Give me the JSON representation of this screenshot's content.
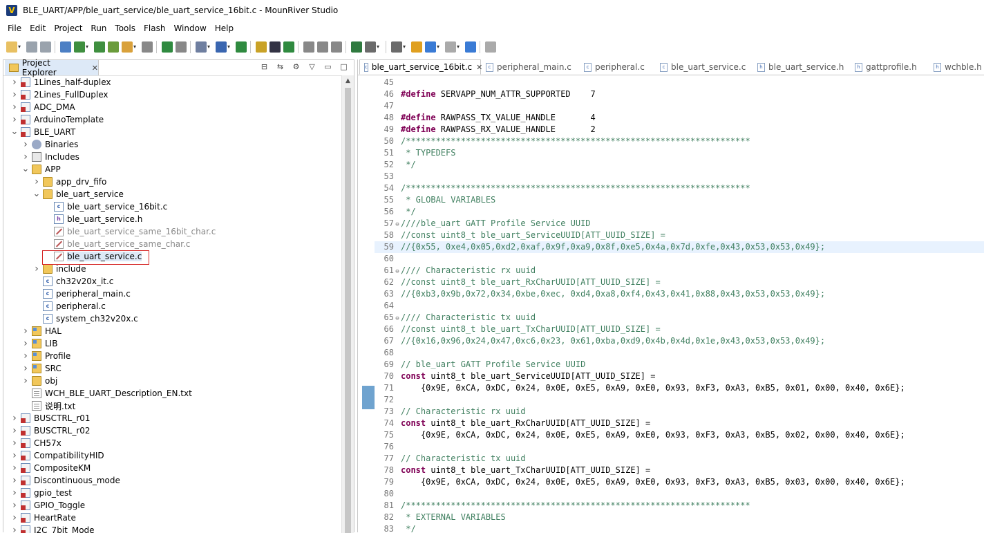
{
  "window": {
    "title": "BLE_UART/APP/ble_uart_service/ble_uart_service_16bit.c - MounRiver Studio",
    "logo": "V"
  },
  "menu": [
    "File",
    "Edit",
    "Project",
    "Run",
    "Tools",
    "Flash",
    "Window",
    "Help"
  ],
  "project_explorer": {
    "tab_label": "Project Explorer",
    "items": [
      {
        "label": "1Lines_half-duplex",
        "icon": "project-icon",
        "chev": ">"
      },
      {
        "label": "2Lines_FullDuplex",
        "icon": "project-icon",
        "chev": ">"
      },
      {
        "label": "ADC_DMA",
        "icon": "project-icon",
        "chev": ">"
      },
      {
        "label": "ArduinoTemplate",
        "icon": "project-icon",
        "chev": ">"
      },
      {
        "label": "BLE_UART",
        "icon": "project-icon",
        "chev": "v"
      },
      {
        "label": "Binaries",
        "icon": "binaries-icon",
        "chev": ">"
      },
      {
        "label": "Includes",
        "icon": "includes-icon",
        "chev": ">"
      },
      {
        "label": "APP",
        "icon": "folder-icon",
        "chev": "v"
      },
      {
        "label": "app_drv_fifo",
        "icon": "folder-icon",
        "chev": ">"
      },
      {
        "label": "ble_uart_service",
        "icon": "folder-icon",
        "chev": "v"
      },
      {
        "label": "ble_uart_service_16bit.c",
        "icon": "c-file-icon",
        "chev": ""
      },
      {
        "label": "ble_uart_service.h",
        "icon": "h-file-icon",
        "chev": ""
      },
      {
        "label": "ble_uart_service_same_16bit_char.c",
        "icon": "excluded-file-icon",
        "chev": ""
      },
      {
        "label": "ble_uart_service_same_char.c",
        "icon": "excluded-file-icon",
        "chev": ""
      },
      {
        "label": "ble_uart_service.c",
        "icon": "excluded-file-icon",
        "chev": ""
      },
      {
        "label": "include",
        "icon": "folder-icon",
        "chev": ">"
      },
      {
        "label": "ch32v20x_it.c",
        "icon": "c-file-icon",
        "chev": ""
      },
      {
        "label": "peripheral_main.c",
        "icon": "c-file-icon",
        "chev": ""
      },
      {
        "label": "peripheral.c",
        "icon": "c-file-icon",
        "chev": ""
      },
      {
        "label": "system_ch32v20x.c",
        "icon": "c-file-icon",
        "chev": ""
      },
      {
        "label": "HAL",
        "icon": "source-folder-icon",
        "chev": ">"
      },
      {
        "label": "LIB",
        "icon": "source-folder-icon",
        "chev": ">"
      },
      {
        "label": "Profile",
        "icon": "source-folder-icon",
        "chev": ">"
      },
      {
        "label": "SRC",
        "icon": "source-folder-icon",
        "chev": ">"
      },
      {
        "label": "obj",
        "icon": "folder-icon",
        "chev": ">"
      },
      {
        "label": "WCH_BLE_UART_Description_EN.txt",
        "icon": "text-file-icon",
        "chev": ""
      },
      {
        "label": "说明.txt",
        "icon": "text-file-icon",
        "chev": ""
      },
      {
        "label": "BUSCTRL_r01",
        "icon": "project-icon",
        "chev": ">"
      },
      {
        "label": "BUSCTRL_r02",
        "icon": "project-icon",
        "chev": ">"
      },
      {
        "label": "CH57x",
        "icon": "project-icon",
        "chev": ">"
      },
      {
        "label": "CompatibilityHID",
        "icon": "project-icon",
        "chev": ">"
      },
      {
        "label": "CompositeKM",
        "icon": "project-icon",
        "chev": ">"
      },
      {
        "label": "Discontinuous_mode",
        "icon": "project-icon",
        "chev": ">"
      },
      {
        "label": "gpio_test",
        "icon": "project-icon",
        "chev": ">"
      },
      {
        "label": "GPIO_Toggle",
        "icon": "project-icon",
        "chev": ">"
      },
      {
        "label": "HeartRate",
        "icon": "project-icon",
        "chev": ">"
      },
      {
        "label": "I2C_7bit_Mode",
        "icon": "project-icon",
        "chev": ">"
      }
    ]
  },
  "editor": {
    "tabs": [
      {
        "label": "ble_uart_service_16bit.c",
        "active": true
      },
      {
        "label": "peripheral_main.c"
      },
      {
        "label": "peripheral.c"
      },
      {
        "label": "ble_uart_service.c"
      },
      {
        "label": "ble_uart_service.h"
      },
      {
        "label": "gattprofile.h"
      },
      {
        "label": "wchble.h"
      }
    ],
    "lines": [
      {
        "n": "45",
        "t": ""
      },
      {
        "n": "46",
        "t": "#define SERVAPP_NUM_ATTR_SUPPORTED    7"
      },
      {
        "n": "47",
        "t": ""
      },
      {
        "n": "48",
        "t": "#define RAWPASS_TX_VALUE_HANDLE       4"
      },
      {
        "n": "49",
        "t": "#define RAWPASS_RX_VALUE_HANDLE       2"
      },
      {
        "n": "50",
        "t": "/*********************************************************************"
      },
      {
        "n": "51",
        "t": " * TYPEDEFS"
      },
      {
        "n": "52",
        "t": " */"
      },
      {
        "n": "53",
        "t": ""
      },
      {
        "n": "54",
        "t": "/*********************************************************************"
      },
      {
        "n": "55",
        "t": " * GLOBAL VARIABLES"
      },
      {
        "n": "56",
        "t": " */"
      },
      {
        "n": "57",
        "t": "////ble_uart GATT Profile Service UUID",
        "fold": true
      },
      {
        "n": "58",
        "t": "//const uint8_t ble_uart_ServiceUUID[ATT_UUID_SIZE] ="
      },
      {
        "n": "59",
        "t": "//{0x55, 0xe4,0x05,0xd2,0xaf,0x9f,0xa9,0x8f,0xe5,0x4a,0x7d,0xfe,0x43,0x53,0x53,0x49};",
        "cur": true
      },
      {
        "n": "60",
        "t": ""
      },
      {
        "n": "61",
        "t": "//// Characteristic rx uuid",
        "fold": true
      },
      {
        "n": "62",
        "t": "//const uint8_t ble_uart_RxCharUUID[ATT_UUID_SIZE] ="
      },
      {
        "n": "63",
        "t": "//{0xb3,0x9b,0x72,0x34,0xbe,0xec, 0xd4,0xa8,0xf4,0x43,0x41,0x88,0x43,0x53,0x53,0x49};"
      },
      {
        "n": "64",
        "t": ""
      },
      {
        "n": "65",
        "t": "//// Characteristic tx uuid",
        "fold": true
      },
      {
        "n": "66",
        "t": "//const uint8_t ble_uart_TxCharUUID[ATT_UUID_SIZE] ="
      },
      {
        "n": "67",
        "t": "//{0x16,0x96,0x24,0x47,0xc6,0x23, 0x61,0xba,0xd9,0x4b,0x4d,0x1e,0x43,0x53,0x53,0x49};"
      },
      {
        "n": "68",
        "t": ""
      },
      {
        "n": "69",
        "t": "// ble_uart GATT Profile Service UUID"
      },
      {
        "n": "70",
        "t": "const uint8_t ble_uart_ServiceUUID[ATT_UUID_SIZE] ="
      },
      {
        "n": "71",
        "t": "    {0x9E, 0xCA, 0xDC, 0x24, 0x0E, 0xE5, 0xA9, 0xE0, 0x93, 0xF3, 0xA3, 0xB5, 0x01, 0x00, 0x40, 0x6E};"
      },
      {
        "n": "72",
        "t": ""
      },
      {
        "n": "73",
        "t": "// Characteristic rx uuid"
      },
      {
        "n": "74",
        "t": "const uint8_t ble_uart_RxCharUUID[ATT_UUID_SIZE] ="
      },
      {
        "n": "75",
        "t": "    {0x9E, 0xCA, 0xDC, 0x24, 0x0E, 0xE5, 0xA9, 0xE0, 0x93, 0xF3, 0xA3, 0xB5, 0x02, 0x00, 0x40, 0x6E};"
      },
      {
        "n": "76",
        "t": ""
      },
      {
        "n": "77",
        "t": "// Characteristic tx uuid"
      },
      {
        "n": "78",
        "t": "const uint8_t ble_uart_TxCharUUID[ATT_UUID_SIZE] ="
      },
      {
        "n": "79",
        "t": "    {0x9E, 0xCA, 0xDC, 0x24, 0x0E, 0xE5, 0xA9, 0xE0, 0x93, 0xF3, 0xA3, 0xB5, 0x03, 0x00, 0x40, 0x6E};"
      },
      {
        "n": "80",
        "t": ""
      },
      {
        "n": "81",
        "t": "/*********************************************************************"
      },
      {
        "n": "82",
        "t": " * EXTERNAL VARIABLES"
      },
      {
        "n": "83",
        "t": " */"
      }
    ]
  },
  "colors": {
    "keyword": "#7f0055",
    "comment": "#3f7f5f",
    "selection": "#dde9f7",
    "highlight_box": "#d62828"
  }
}
